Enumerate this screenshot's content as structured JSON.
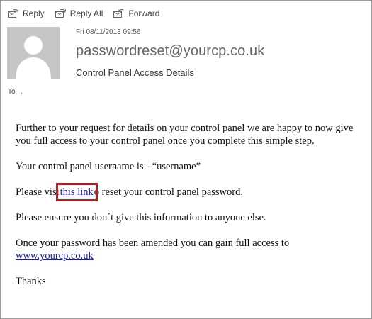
{
  "toolbar": {
    "reply_label": "Reply",
    "reply_all_label": "Reply All",
    "forward_label": "Forward"
  },
  "header": {
    "date": "Fri 08/11/2013 09:56",
    "from": "passwordreset@yourcp.co.uk",
    "subject": "Control Panel Access Details",
    "to_label": "To",
    "to_value": "."
  },
  "body": {
    "p1": "Further to your request for details on your control panel we are happy to now give you full access to your control panel once you complete this simple step.",
    "p2": "Your control panel username is - “username”",
    "p3_before": "Please visi",
    "p3_link": "this link",
    "p3_after": "o reset your control panel password.",
    "p4": "Please ensure you don´t give this information to anyone else.",
    "p5_text": "Once your password has been amended you can gain full access to",
    "p5_link": "www.yourcp.co.uk",
    "p6": "Thanks"
  },
  "colors": {
    "highlight": "#b01f24",
    "link": "#1a1aa6",
    "avatar_bg": "#c6c6c6"
  }
}
